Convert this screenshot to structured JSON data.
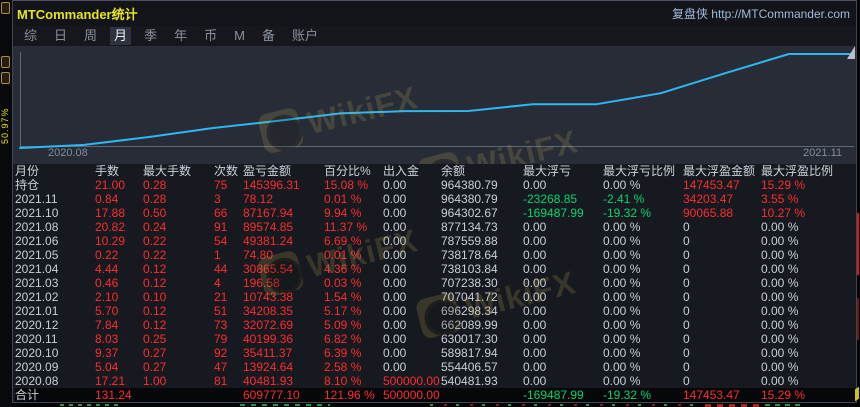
{
  "window": {
    "title": "MTCommander统计",
    "brand": "复盘侠 http://MTCommander.com"
  },
  "menu": {
    "items": [
      {
        "label": "综",
        "active": false
      },
      {
        "label": "日",
        "active": false
      },
      {
        "label": "周",
        "active": false
      },
      {
        "label": "月",
        "active": true
      },
      {
        "label": "季",
        "active": false
      },
      {
        "label": "年",
        "active": false
      },
      {
        "label": "币",
        "active": false
      },
      {
        "label": "M",
        "active": false
      },
      {
        "label": "备",
        "active": false
      },
      {
        "label": "账户",
        "active": false
      }
    ]
  },
  "side_strip": {
    "vertical_label": "50.97%"
  },
  "watermark": {
    "label": "WikiFX"
  },
  "chart_data": {
    "type": "line",
    "title": "",
    "xlabel": "",
    "ylabel": "",
    "x": [
      "2020.08",
      "2020.09",
      "2020.10",
      "2020.11",
      "2020.12",
      "2021.01",
      "2021.02",
      "2021.03",
      "2021.04",
      "2021.05",
      "2021.06",
      "2021.08",
      "2021.10",
      "2021.11"
    ],
    "series": [
      {
        "name": "余额",
        "values": [
          540481.93,
          554406.57,
          589817.94,
          630017.3,
          662089.99,
          696298.34,
          707041.72,
          707238.3,
          738103.84,
          738178.64,
          787559.88,
          877134.73,
          964302.67,
          964380.79
        ]
      }
    ],
    "ylim": [
      540481.93,
      964380.79
    ],
    "x_axis_labels": {
      "left": "2020.08",
      "right": "2021.11"
    },
    "line_color": "#2cb8f0",
    "grid": false,
    "legend": "none"
  },
  "table": {
    "colors": {
      "r": "#fe2c2c",
      "g": "#00d76c",
      "w": "#c9ced8"
    },
    "columns": [
      "月份",
      "手数",
      "最大手数",
      "次数",
      "盈亏金额",
      "百分比%",
      "出入金",
      "余额",
      "最大浮亏",
      "最大浮亏比例",
      "最大浮盈金额",
      "最大浮盈比例"
    ],
    "rows": [
      {
        "cells": [
          [
            "持仓",
            "w"
          ],
          [
            "21.00",
            "r"
          ],
          [
            "0.28",
            "r"
          ],
          [
            "75",
            "r"
          ],
          [
            "145396.31",
            "r"
          ],
          [
            "15.08 %",
            "r"
          ],
          [
            "0.00",
            "w"
          ],
          [
            "964380.79",
            "w"
          ],
          [
            "0.00",
            "w"
          ],
          [
            "0.00 %",
            "w"
          ],
          [
            "147453.47",
            "r"
          ],
          [
            "15.29 %",
            "r"
          ]
        ]
      },
      {
        "cells": [
          [
            "2021.11",
            "w"
          ],
          [
            "0.84",
            "r"
          ],
          [
            "0.28",
            "r"
          ],
          [
            "3",
            "r"
          ],
          [
            "78.12",
            "r"
          ],
          [
            "0.01 %",
            "r"
          ],
          [
            "0.00",
            "w"
          ],
          [
            "964380.79",
            "w"
          ],
          [
            "-23268.85",
            "g"
          ],
          [
            "-2.41 %",
            "g"
          ],
          [
            "34203.47",
            "r"
          ],
          [
            "3.55 %",
            "r"
          ]
        ]
      },
      {
        "cells": [
          [
            "2021.10",
            "w"
          ],
          [
            "17.88",
            "r"
          ],
          [
            "0.50",
            "r"
          ],
          [
            "66",
            "r"
          ],
          [
            "87167.94",
            "r"
          ],
          [
            "9.94 %",
            "r"
          ],
          [
            "0.00",
            "w"
          ],
          [
            "964302.67",
            "w"
          ],
          [
            "-169487.99",
            "g"
          ],
          [
            "-19.32 %",
            "g"
          ],
          [
            "90065.88",
            "r"
          ],
          [
            "10.27 %",
            "r"
          ]
        ]
      },
      {
        "cells": [
          [
            "2021.08",
            "w"
          ],
          [
            "20.82",
            "r"
          ],
          [
            "0.24",
            "r"
          ],
          [
            "91",
            "r"
          ],
          [
            "89574.85",
            "r"
          ],
          [
            "11.37 %",
            "r"
          ],
          [
            "0.00",
            "w"
          ],
          [
            "877134.73",
            "w"
          ],
          [
            "0.00",
            "w"
          ],
          [
            "0.00 %",
            "w"
          ],
          [
            "0",
            "w"
          ],
          [
            "0.00 %",
            "w"
          ]
        ]
      },
      {
        "cells": [
          [
            "2021.06",
            "w"
          ],
          [
            "10.29",
            "r"
          ],
          [
            "0.22",
            "r"
          ],
          [
            "54",
            "r"
          ],
          [
            "49381.24",
            "r"
          ],
          [
            "6.69 %",
            "r"
          ],
          [
            "0.00",
            "w"
          ],
          [
            "787559.88",
            "w"
          ],
          [
            "0.00",
            "w"
          ],
          [
            "0.00 %",
            "w"
          ],
          [
            "0",
            "w"
          ],
          [
            "0.00 %",
            "w"
          ]
        ]
      },
      {
        "cells": [
          [
            "2021.05",
            "w"
          ],
          [
            "0.22",
            "r"
          ],
          [
            "0.22",
            "r"
          ],
          [
            "1",
            "r"
          ],
          [
            "74.80",
            "r"
          ],
          [
            "0.01 %",
            "r"
          ],
          [
            "0.00",
            "w"
          ],
          [
            "738178.64",
            "w"
          ],
          [
            "0.00",
            "w"
          ],
          [
            "0.00 %",
            "w"
          ],
          [
            "0",
            "w"
          ],
          [
            "0.00 %",
            "w"
          ]
        ]
      },
      {
        "cells": [
          [
            "2021.04",
            "w"
          ],
          [
            "4.44",
            "r"
          ],
          [
            "0.12",
            "r"
          ],
          [
            "44",
            "r"
          ],
          [
            "30865.54",
            "r"
          ],
          [
            "4.36 %",
            "r"
          ],
          [
            "0.00",
            "w"
          ],
          [
            "738103.84",
            "w"
          ],
          [
            "0.00",
            "w"
          ],
          [
            "0.00 %",
            "w"
          ],
          [
            "0",
            "w"
          ],
          [
            "0.00 %",
            "w"
          ]
        ]
      },
      {
        "cells": [
          [
            "2021.03",
            "w"
          ],
          [
            "0.46",
            "r"
          ],
          [
            "0.12",
            "r"
          ],
          [
            "4",
            "r"
          ],
          [
            "196.58",
            "r"
          ],
          [
            "0.03 %",
            "r"
          ],
          [
            "0.00",
            "w"
          ],
          [
            "707238.30",
            "w"
          ],
          [
            "0.00",
            "w"
          ],
          [
            "0.00 %",
            "w"
          ],
          [
            "0",
            "w"
          ],
          [
            "0.00 %",
            "w"
          ]
        ]
      },
      {
        "cells": [
          [
            "2021.02",
            "w"
          ],
          [
            "2.10",
            "r"
          ],
          [
            "0.10",
            "r"
          ],
          [
            "21",
            "r"
          ],
          [
            "10743.38",
            "r"
          ],
          [
            "1.54 %",
            "r"
          ],
          [
            "0.00",
            "w"
          ],
          [
            "707041.72",
            "w"
          ],
          [
            "0.00",
            "w"
          ],
          [
            "0.00 %",
            "w"
          ],
          [
            "0",
            "w"
          ],
          [
            "0.00 %",
            "w"
          ]
        ]
      },
      {
        "cells": [
          [
            "2021.01",
            "w"
          ],
          [
            "5.70",
            "r"
          ],
          [
            "0.12",
            "r"
          ],
          [
            "51",
            "r"
          ],
          [
            "34208.35",
            "r"
          ],
          [
            "5.17 %",
            "r"
          ],
          [
            "0.00",
            "w"
          ],
          [
            "696298.34",
            "w"
          ],
          [
            "0.00",
            "w"
          ],
          [
            "0.00 %",
            "w"
          ],
          [
            "0",
            "w"
          ],
          [
            "0.00 %",
            "w"
          ]
        ]
      },
      {
        "cells": [
          [
            "2020.12",
            "w"
          ],
          [
            "7.84",
            "r"
          ],
          [
            "0.12",
            "r"
          ],
          [
            "73",
            "r"
          ],
          [
            "32072.69",
            "r"
          ],
          [
            "5.09 %",
            "r"
          ],
          [
            "0.00",
            "w"
          ],
          [
            "662089.99",
            "w"
          ],
          [
            "0.00",
            "w"
          ],
          [
            "0.00 %",
            "w"
          ],
          [
            "0",
            "w"
          ],
          [
            "0.00 %",
            "w"
          ]
        ]
      },
      {
        "cells": [
          [
            "2020.11",
            "w"
          ],
          [
            "8.03",
            "r"
          ],
          [
            "0.25",
            "r"
          ],
          [
            "79",
            "r"
          ],
          [
            "40199.36",
            "r"
          ],
          [
            "6.82 %",
            "r"
          ],
          [
            "0.00",
            "w"
          ],
          [
            "630017.30",
            "w"
          ],
          [
            "0.00",
            "w"
          ],
          [
            "0.00 %",
            "w"
          ],
          [
            "0",
            "w"
          ],
          [
            "0.00 %",
            "w"
          ]
        ]
      },
      {
        "cells": [
          [
            "2020.10",
            "w"
          ],
          [
            "9.37",
            "r"
          ],
          [
            "0.27",
            "r"
          ],
          [
            "92",
            "r"
          ],
          [
            "35411.37",
            "r"
          ],
          [
            "6.39 %",
            "r"
          ],
          [
            "0.00",
            "w"
          ],
          [
            "589817.94",
            "w"
          ],
          [
            "0.00",
            "w"
          ],
          [
            "0.00 %",
            "w"
          ],
          [
            "0",
            "w"
          ],
          [
            "0.00 %",
            "w"
          ]
        ]
      },
      {
        "cells": [
          [
            "2020.09",
            "w"
          ],
          [
            "5.04",
            "r"
          ],
          [
            "0.27",
            "r"
          ],
          [
            "47",
            "r"
          ],
          [
            "13924.64",
            "r"
          ],
          [
            "2.58 %",
            "r"
          ],
          [
            "0.00",
            "w"
          ],
          [
            "554406.57",
            "w"
          ],
          [
            "0.00",
            "w"
          ],
          [
            "0.00 %",
            "w"
          ],
          [
            "0",
            "w"
          ],
          [
            "0.00 %",
            "w"
          ]
        ]
      },
      {
        "cells": [
          [
            "2020.08",
            "w"
          ],
          [
            "17.21",
            "r"
          ],
          [
            "1.00",
            "r"
          ],
          [
            "81",
            "r"
          ],
          [
            "40481.93",
            "r"
          ],
          [
            "8.10 %",
            "r"
          ],
          [
            "500000.00",
            "r"
          ],
          [
            "540481.93",
            "w"
          ],
          [
            "0.00",
            "w"
          ],
          [
            "0.00 %",
            "w"
          ],
          [
            "0",
            "w"
          ],
          [
            "0.00 %",
            "w"
          ]
        ]
      },
      {
        "total": true,
        "cells": [
          [
            "合计",
            "w"
          ],
          [
            "131.24",
            "r"
          ],
          [
            "",
            ""
          ],
          [
            "",
            ""
          ],
          [
            "609777.10",
            "r"
          ],
          [
            "121.96 %",
            "r"
          ],
          [
            "500000.00",
            "r"
          ],
          [
            "",
            ""
          ],
          [
            "-169487.99",
            "g"
          ],
          [
            "-19.32 %",
            "g"
          ],
          [
            "147453.47",
            "r"
          ],
          [
            "15.29 %",
            "r"
          ]
        ]
      }
    ]
  }
}
